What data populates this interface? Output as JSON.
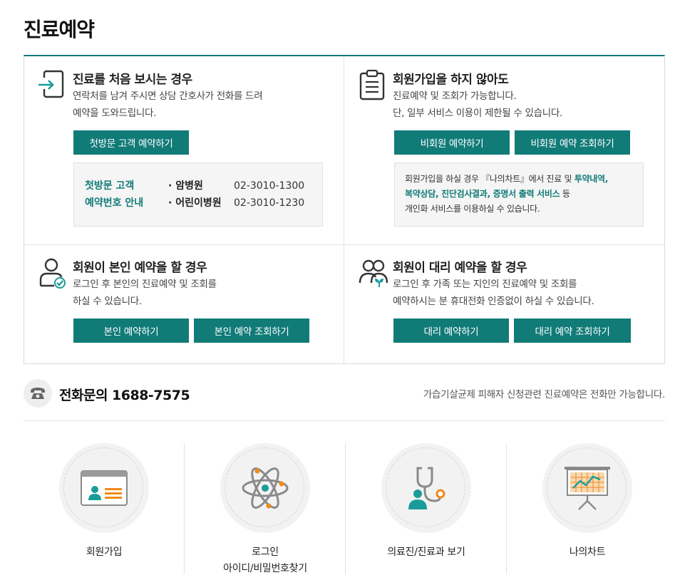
{
  "page": {
    "title": "진료예약"
  },
  "sections": {
    "first_visit": {
      "title": "진료를 처음 보시는 경우",
      "desc_1": "연락처를 남겨 주시면 상담 간호사가 전화를 드려",
      "desc_2": "예약을 도와드립니다.",
      "button": "첫방문 고객 예약하기",
      "info_title_1": "첫방문 고객",
      "info_title_2": "예약번호 안내",
      "contacts": [
        {
          "name": "· 암병원",
          "phone": "02-3010-1300"
        },
        {
          "name": "· 어린이병원",
          "phone": "02-3010-1230"
        }
      ]
    },
    "non_member": {
      "title": "회원가입을 하지 않아도",
      "desc_1": "진료예약 및 조회가 가능합니다.",
      "desc_2": "단, 일부 서비스 이용이 제한될 수 있습니다.",
      "button_reserve": "비회원 예약하기",
      "button_check": "비회원 예약 조회하기",
      "info_pre": "회원가입을 하실 경우 『나의차트』에서 진료 및 ",
      "info_hl_1": "투약내역,",
      "info_hl_2": "복약상담, 진단검사결과, 증명서 출력 서비스",
      "info_mid": " 등",
      "info_last": "개인화 서비스를 이용하실 수 있습니다."
    },
    "self": {
      "title": "회원이 본인 예약을 할 경우",
      "desc_1": "로그인 후 본인의 진료예약 및 조회를",
      "desc_2": "하실 수 있습니다.",
      "button_reserve": "본인 예약하기",
      "button_check": "본인 예약 조회하기"
    },
    "proxy": {
      "title": "회원이 대리 예약을 할 경우",
      "desc_1": "로그인 후 가족 또는 지인의 진료예약 및 조회를",
      "desc_2": "예약하시는 분 휴대전화 인증없이 하실 수 있습니다.",
      "button_reserve": "대리 예약하기",
      "button_check": "대리 예약 조회하기"
    }
  },
  "phone": {
    "label": "전화문의 1688-7575",
    "note": "가습기살균제 피해자 신청관련 진료예약은 전화만 가능합니다."
  },
  "quick_links": {
    "signup": "회원가입",
    "login_1": "로그인",
    "login_2": "아이디/비밀번호찾기",
    "doctors": "의료진/진료과 보기",
    "mychart": "나의차트"
  },
  "colors": {
    "accent": "#117b78",
    "highlight": "#117b78",
    "orange": "#f08a1c"
  }
}
